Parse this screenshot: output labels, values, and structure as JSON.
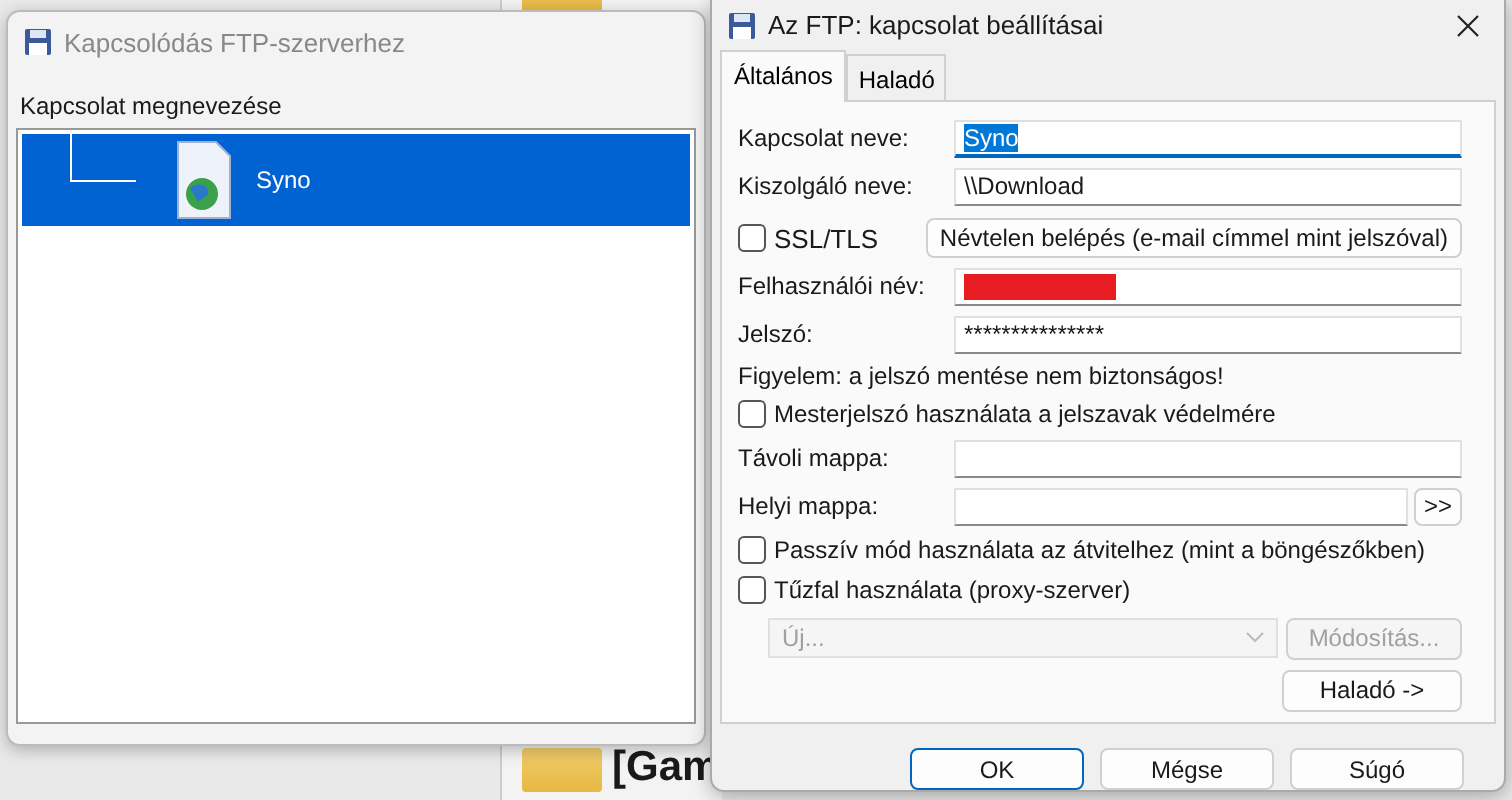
{
  "background": {
    "folder_label": "[Gam"
  },
  "connect_window": {
    "title": "Kapcsolódás FTP-szerverhez",
    "list_header": "Kapcsolat megnevezése",
    "connections": [
      {
        "name": "Syno",
        "selected": true
      }
    ]
  },
  "settings_dialog": {
    "title": "Az FTP: kapcsolat beállításai",
    "tabs": [
      {
        "label": "Általános",
        "selected": true
      },
      {
        "label": "Haladó",
        "selected": false
      }
    ],
    "rows": [
      {
        "kind": "field",
        "label": "Kapcsolat neve:",
        "value": "Syno",
        "focused": true
      },
      {
        "kind": "field",
        "label": "Kiszolgáló neve:",
        "value": "\\\\Download",
        "focused": false
      },
      {
        "kind": "check_button",
        "label": "SSL/TLS",
        "checked": false,
        "button": "Névtelen belépés (e-mail címmel mint jelszóval)"
      },
      {
        "kind": "field",
        "label": "Felhasználói név:",
        "redacted": true,
        "focused": false
      },
      {
        "kind": "field",
        "label": "Jelszó:",
        "value": "***************",
        "focused": false
      },
      {
        "kind": "note",
        "text": "Figyelem: a jelszó mentése nem biztonságos!"
      },
      {
        "kind": "check",
        "label": "Mesterjelszó használata a jelszavak védelmére",
        "checked": false
      },
      {
        "kind": "field",
        "label": "Távoli mappa:",
        "focused": false
      },
      {
        "kind": "browse",
        "label": "Helyi mappa:",
        "button": ">>"
      },
      {
        "kind": "check",
        "label": "Passzív mód használata az átvitelhez (mint a böngészőkben)",
        "checked": false
      },
      {
        "kind": "check",
        "label": "Tűzfal használata (proxy-szerver)",
        "checked": false
      },
      {
        "kind": "proxy",
        "select": "Új...",
        "button": "Módosítás...",
        "disabled": true
      },
      {
        "kind": "button_right",
        "button": "Haladó ->"
      }
    ],
    "footer_buttons": [
      {
        "label": "OK",
        "default": true
      },
      {
        "label": "Mégse",
        "default": false
      },
      {
        "label": "Súgó",
        "default": false
      }
    ]
  }
}
